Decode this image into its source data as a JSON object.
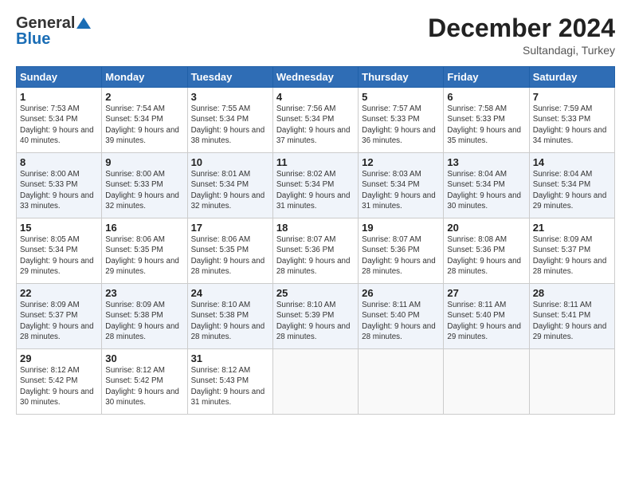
{
  "header": {
    "logo_line1": "General",
    "logo_line2": "Blue",
    "month_title": "December 2024",
    "location": "Sultandagi, Turkey"
  },
  "weekdays": [
    "Sunday",
    "Monday",
    "Tuesday",
    "Wednesday",
    "Thursday",
    "Friday",
    "Saturday"
  ],
  "weeks": [
    [
      {
        "day": "1",
        "sunrise": "7:53 AM",
        "sunset": "5:34 PM",
        "daylight": "9 hours and 40 minutes."
      },
      {
        "day": "2",
        "sunrise": "7:54 AM",
        "sunset": "5:34 PM",
        "daylight": "9 hours and 39 minutes."
      },
      {
        "day": "3",
        "sunrise": "7:55 AM",
        "sunset": "5:34 PM",
        "daylight": "9 hours and 38 minutes."
      },
      {
        "day": "4",
        "sunrise": "7:56 AM",
        "sunset": "5:34 PM",
        "daylight": "9 hours and 37 minutes."
      },
      {
        "day": "5",
        "sunrise": "7:57 AM",
        "sunset": "5:33 PM",
        "daylight": "9 hours and 36 minutes."
      },
      {
        "day": "6",
        "sunrise": "7:58 AM",
        "sunset": "5:33 PM",
        "daylight": "9 hours and 35 minutes."
      },
      {
        "day": "7",
        "sunrise": "7:59 AM",
        "sunset": "5:33 PM",
        "daylight": "9 hours and 34 minutes."
      }
    ],
    [
      {
        "day": "8",
        "sunrise": "8:00 AM",
        "sunset": "5:33 PM",
        "daylight": "9 hours and 33 minutes."
      },
      {
        "day": "9",
        "sunrise": "8:00 AM",
        "sunset": "5:33 PM",
        "daylight": "9 hours and 32 minutes."
      },
      {
        "day": "10",
        "sunrise": "8:01 AM",
        "sunset": "5:34 PM",
        "daylight": "9 hours and 32 minutes."
      },
      {
        "day": "11",
        "sunrise": "8:02 AM",
        "sunset": "5:34 PM",
        "daylight": "9 hours and 31 minutes."
      },
      {
        "day": "12",
        "sunrise": "8:03 AM",
        "sunset": "5:34 PM",
        "daylight": "9 hours and 31 minutes."
      },
      {
        "day": "13",
        "sunrise": "8:04 AM",
        "sunset": "5:34 PM",
        "daylight": "9 hours and 30 minutes."
      },
      {
        "day": "14",
        "sunrise": "8:04 AM",
        "sunset": "5:34 PM",
        "daylight": "9 hours and 29 minutes."
      }
    ],
    [
      {
        "day": "15",
        "sunrise": "8:05 AM",
        "sunset": "5:34 PM",
        "daylight": "9 hours and 29 minutes."
      },
      {
        "day": "16",
        "sunrise": "8:06 AM",
        "sunset": "5:35 PM",
        "daylight": "9 hours and 29 minutes."
      },
      {
        "day": "17",
        "sunrise": "8:06 AM",
        "sunset": "5:35 PM",
        "daylight": "9 hours and 28 minutes."
      },
      {
        "day": "18",
        "sunrise": "8:07 AM",
        "sunset": "5:36 PM",
        "daylight": "9 hours and 28 minutes."
      },
      {
        "day": "19",
        "sunrise": "8:07 AM",
        "sunset": "5:36 PM",
        "daylight": "9 hours and 28 minutes."
      },
      {
        "day": "20",
        "sunrise": "8:08 AM",
        "sunset": "5:36 PM",
        "daylight": "9 hours and 28 minutes."
      },
      {
        "day": "21",
        "sunrise": "8:09 AM",
        "sunset": "5:37 PM",
        "daylight": "9 hours and 28 minutes."
      }
    ],
    [
      {
        "day": "22",
        "sunrise": "8:09 AM",
        "sunset": "5:37 PM",
        "daylight": "9 hours and 28 minutes."
      },
      {
        "day": "23",
        "sunrise": "8:09 AM",
        "sunset": "5:38 PM",
        "daylight": "9 hours and 28 minutes."
      },
      {
        "day": "24",
        "sunrise": "8:10 AM",
        "sunset": "5:38 PM",
        "daylight": "9 hours and 28 minutes."
      },
      {
        "day": "25",
        "sunrise": "8:10 AM",
        "sunset": "5:39 PM",
        "daylight": "9 hours and 28 minutes."
      },
      {
        "day": "26",
        "sunrise": "8:11 AM",
        "sunset": "5:40 PM",
        "daylight": "9 hours and 28 minutes."
      },
      {
        "day": "27",
        "sunrise": "8:11 AM",
        "sunset": "5:40 PM",
        "daylight": "9 hours and 29 minutes."
      },
      {
        "day": "28",
        "sunrise": "8:11 AM",
        "sunset": "5:41 PM",
        "daylight": "9 hours and 29 minutes."
      }
    ],
    [
      {
        "day": "29",
        "sunrise": "8:12 AM",
        "sunset": "5:42 PM",
        "daylight": "9 hours and 30 minutes."
      },
      {
        "day": "30",
        "sunrise": "8:12 AM",
        "sunset": "5:42 PM",
        "daylight": "9 hours and 30 minutes."
      },
      {
        "day": "31",
        "sunrise": "8:12 AM",
        "sunset": "5:43 PM",
        "daylight": "9 hours and 31 minutes."
      },
      null,
      null,
      null,
      null
    ]
  ]
}
